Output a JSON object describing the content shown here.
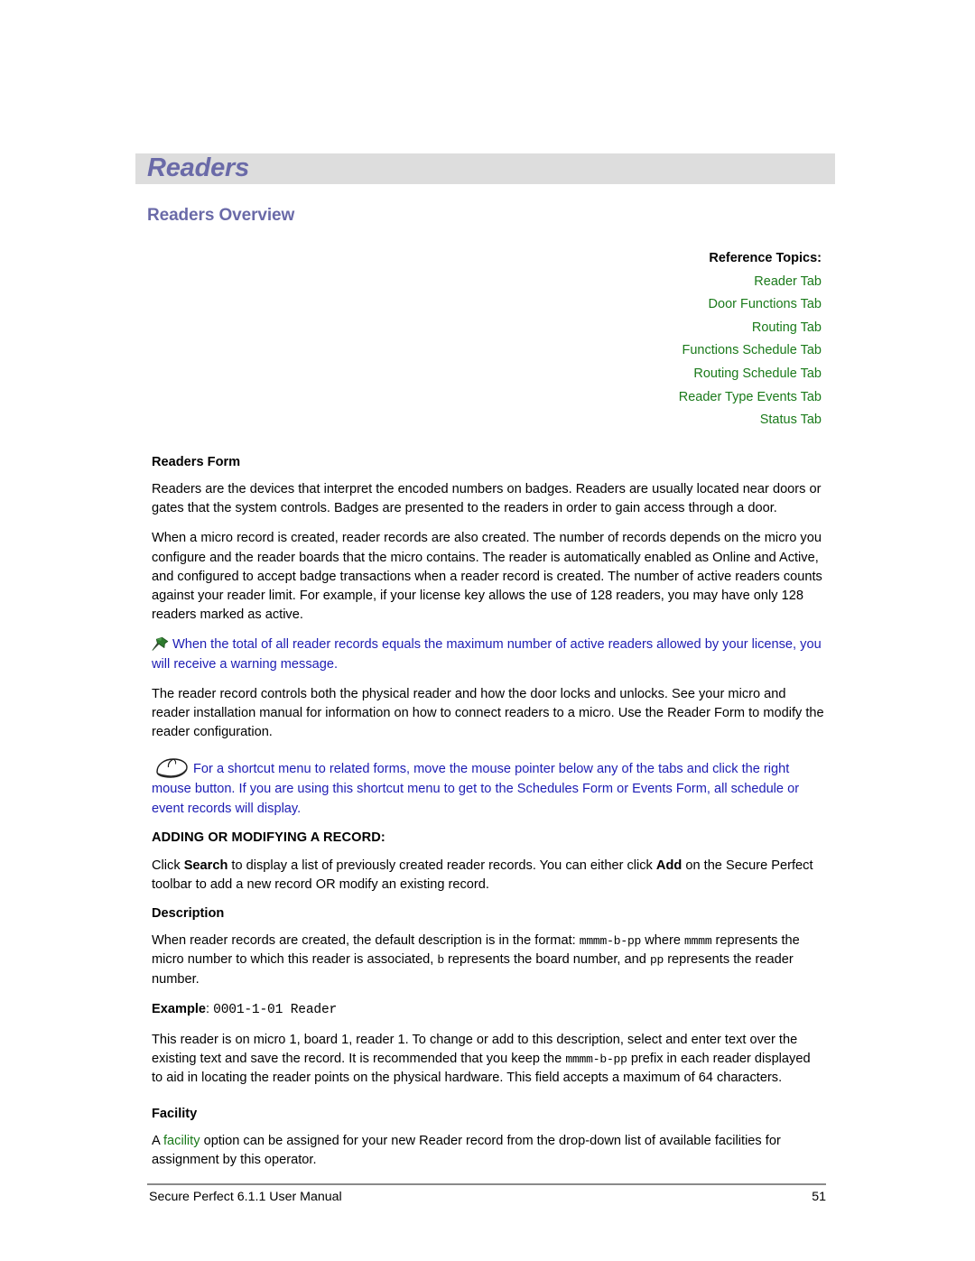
{
  "document": {
    "title_banner": "Readers",
    "section_heading": "Readers Overview"
  },
  "reference_topics": {
    "label": "Reference Topics:",
    "items": [
      "Reader Tab",
      "Door Functions Tab",
      "Routing Tab",
      "Functions Schedule Tab",
      "Routing Schedule Tab",
      "Reader Type Events Tab",
      "Status Tab"
    ]
  },
  "readers_form": {
    "heading": "Readers Form",
    "paragraph_1": "Readers are the devices that interpret the encoded numbers on badges. Readers are usually located near doors or gates that the system controls. Badges are presented to the readers in order to gain access through a door.",
    "paragraph_2": "When a micro record is created, reader records are also created. The number of records depends on the micro you configure and the reader boards that the micro contains. The reader is automatically enabled as Online and Active, and configured to accept badge transactions when a reader record is created. The number of active readers counts against your reader limit. For example, if your license key allows the use of 128 readers, you may have only 128 readers marked as active.",
    "note_pin": "When the total of all reader records equals the maximum number of active readers allowed by your license, you will receive a warning message.",
    "paragraph_3": "The reader record controls both the physical reader and how the door locks and unlocks. See your micro and reader installation manual for information on how to connect readers to a micro. Use the Reader Form to modify the reader configuration.",
    "note_mouse": "For a shortcut menu to related forms, move the mouse pointer below any of the tabs and click the right mouse button. If you are using this shortcut menu to get to the Schedules Form or Events Form, all schedule or event records will display."
  },
  "adding_record": {
    "heading": "ADDING OR MODIFYING A RECORD:",
    "paragraph_pre": "Click ",
    "bold_search": "Search",
    "paragraph_mid": " to display a list of previously created reader records. You can either click ",
    "bold_add": "Add",
    "paragraph_post": " on the Secure Perfect toolbar to add a new record OR modify an existing record."
  },
  "description": {
    "heading": "Description",
    "text_1": "When reader records are created, the default description is in the format: ",
    "code_format_1": "mmmm-b-pp",
    "text_2": " where ",
    "code_mmmm": "mmmm",
    "text_3": " represents the micro number to which this reader is associated, ",
    "code_b": "b",
    "text_4": " represents the board number, and ",
    "code_pp": "pp",
    "text_5": " represents the reader number.",
    "example_label": "Example",
    "example_separator": ": ",
    "example_value": "0001-1-01 Reader",
    "text_6": "This reader is on micro 1, board 1, reader 1. To change or add to this description, select and enter text over the existing text and save the record. It is recommended that you keep the ",
    "code_format_2": "mmmm-b-pp",
    "text_7": " prefix in each reader displayed to aid in locating the reader points on the physical hardware. This field accepts a maximum of 64 characters."
  },
  "facility": {
    "heading": "Facility",
    "text_pre": "A ",
    "link": "facility",
    "text_post": " option can be assigned for your new Reader record from the drop-down list of available facilities for assignment by this operator."
  },
  "footer": {
    "left": "Secure Perfect 6.1.1 User Manual",
    "page_number": "51"
  },
  "colors": {
    "banner_bg": "#dddddd",
    "heading_purple": "#6a6aa8",
    "link_green": "#1a7a1a",
    "note_blue": "#1d1db4",
    "text_black": "#000000"
  },
  "icons": {
    "pin": "pushpin-icon",
    "mouse": "computer-mouse-icon"
  }
}
